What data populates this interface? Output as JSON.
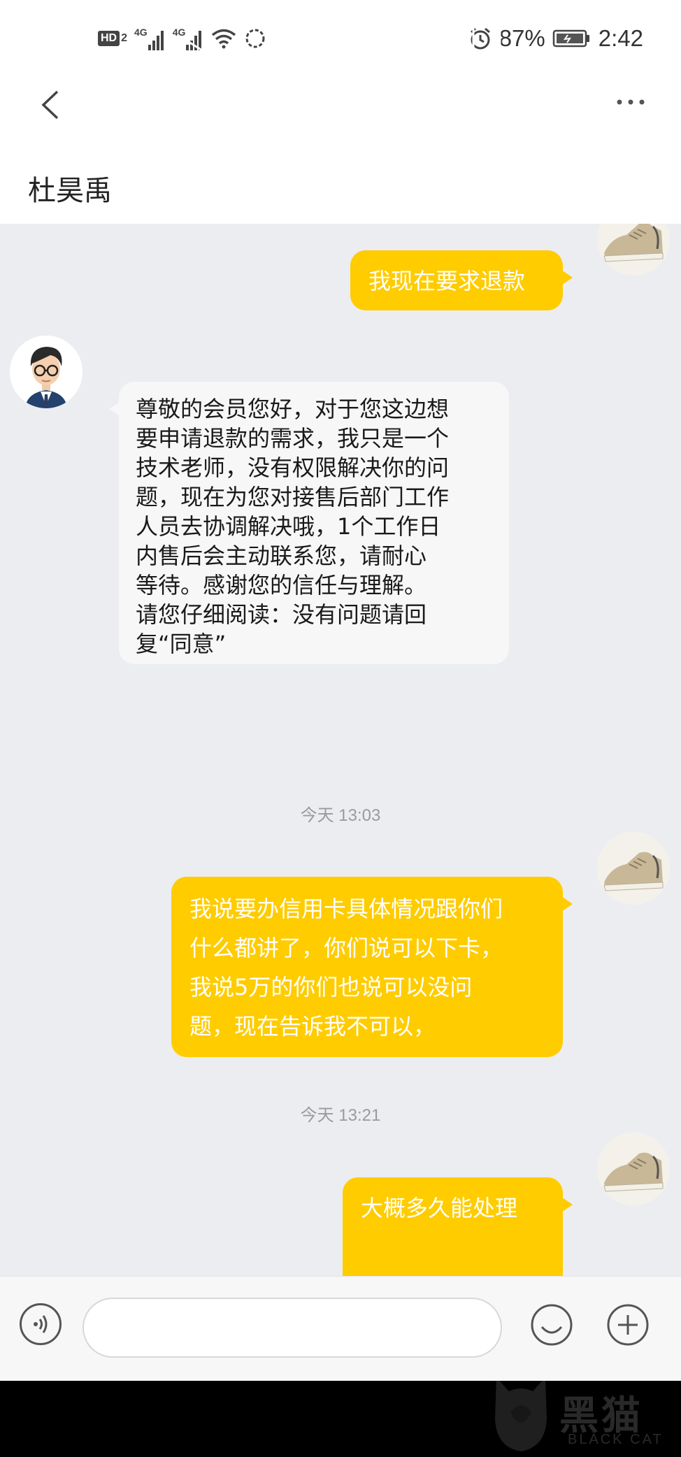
{
  "status_bar": {
    "hd_label": "HD",
    "hd_sub": "2",
    "network1": "4G",
    "network2": "4G",
    "battery": "87%",
    "time": "2:42"
  },
  "header": {
    "title": "杜昊禹"
  },
  "messages": [
    {
      "from": "me",
      "text": "我现在要求退款"
    },
    {
      "from": "them",
      "lines": [
        "尊敬的会员您好，对于您这边想",
        "要申请退款的需求，我只是一个",
        "技术老师，没有权限解决你的问",
        "题，现在为您对接售后部门工作",
        "人员去协调解决哦，1个工作日",
        "内售后会主动联系您，请耐心",
        "等待。感谢您的信任与理解。",
        "请您仔细阅读：没有问题请回",
        "复“同意”"
      ]
    },
    {
      "timestamp": "今天 13:03"
    },
    {
      "from": "me",
      "lines": [
        "我说要办信用卡具体情况跟你们",
        "什么都讲了，你们说可以下卡，",
        "我说5万的你们也说可以没问",
        "题，现在告诉我不可以，"
      ]
    },
    {
      "timestamp": "今天 13:21"
    },
    {
      "from": "me",
      "text": "大概多久能处理"
    }
  ],
  "watermark": {
    "text_cn": "黑猫",
    "text_en": "BLACK CAT"
  }
}
